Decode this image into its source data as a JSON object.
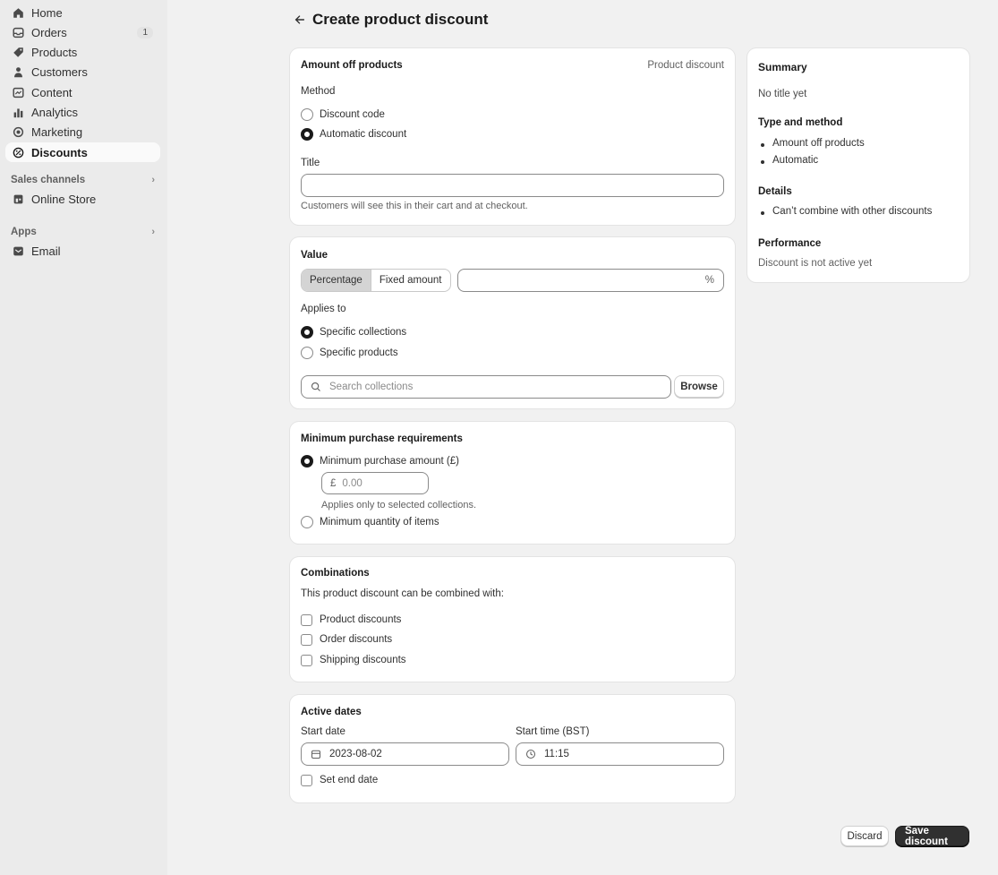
{
  "sidebar": {
    "items": [
      {
        "label": "Home",
        "icon": "home-icon"
      },
      {
        "label": "Orders",
        "icon": "orders-icon",
        "badge": "1"
      },
      {
        "label": "Products",
        "icon": "tag-icon"
      },
      {
        "label": "Customers",
        "icon": "person-icon"
      },
      {
        "label": "Content",
        "icon": "content-icon"
      },
      {
        "label": "Analytics",
        "icon": "bar-chart-icon"
      },
      {
        "label": "Marketing",
        "icon": "target-icon"
      },
      {
        "label": "Discounts",
        "icon": "discount-icon"
      }
    ],
    "sales_channels_label": "Sales channels",
    "online_store_label": "Online Store",
    "apps_label": "Apps",
    "email_label": "Email"
  },
  "header": {
    "title": "Create product discount"
  },
  "amount": {
    "title": "Amount off products",
    "type_label": "Product discount",
    "method_label": "Method",
    "method_options": [
      "Discount code",
      "Automatic discount"
    ],
    "method_selected": "Automatic discount",
    "title_field_label": "Title",
    "title_value": "",
    "title_help": "Customers will see this in their cart and at checkout."
  },
  "value": {
    "title": "Value",
    "seg_percentage": "Percentage",
    "seg_fixed": "Fixed amount",
    "selected": "Percentage",
    "value_input": "",
    "suffix": "%",
    "applies_to_label": "Applies to",
    "applies_options": [
      "Specific collections",
      "Specific products"
    ],
    "applies_selected": "Specific collections",
    "search_placeholder": "Search collections",
    "browse_label": "Browse"
  },
  "minimum": {
    "title": "Minimum purchase requirements",
    "option_amount": "Minimum purchase amount (£)",
    "currency_prefix": "£",
    "amount_placeholder": "0.00",
    "amount_help": "Applies only to selected collections.",
    "option_quantity": "Minimum quantity of items",
    "selected": "Minimum purchase amount (£)"
  },
  "combinations": {
    "title": "Combinations",
    "description": "This product discount can be combined with:",
    "options": [
      "Product discounts",
      "Order discounts",
      "Shipping discounts"
    ]
  },
  "dates": {
    "title": "Active dates",
    "start_date_label": "Start date",
    "start_date_value": "2023-08-02",
    "start_time_label": "Start time (BST)",
    "start_time_value": "11:15",
    "end_date_label": "Set end date"
  },
  "summary": {
    "title": "Summary",
    "no_title": "No title yet",
    "type_method_label": "Type and method",
    "type_method_items": [
      "Amount off products",
      "Automatic"
    ],
    "details_label": "Details",
    "details_items": [
      "Can’t combine with other discounts"
    ],
    "performance_label": "Performance",
    "performance_text": "Discount is not active yet"
  },
  "footer": {
    "discard_label": "Discard",
    "save_label": "Save discount"
  }
}
